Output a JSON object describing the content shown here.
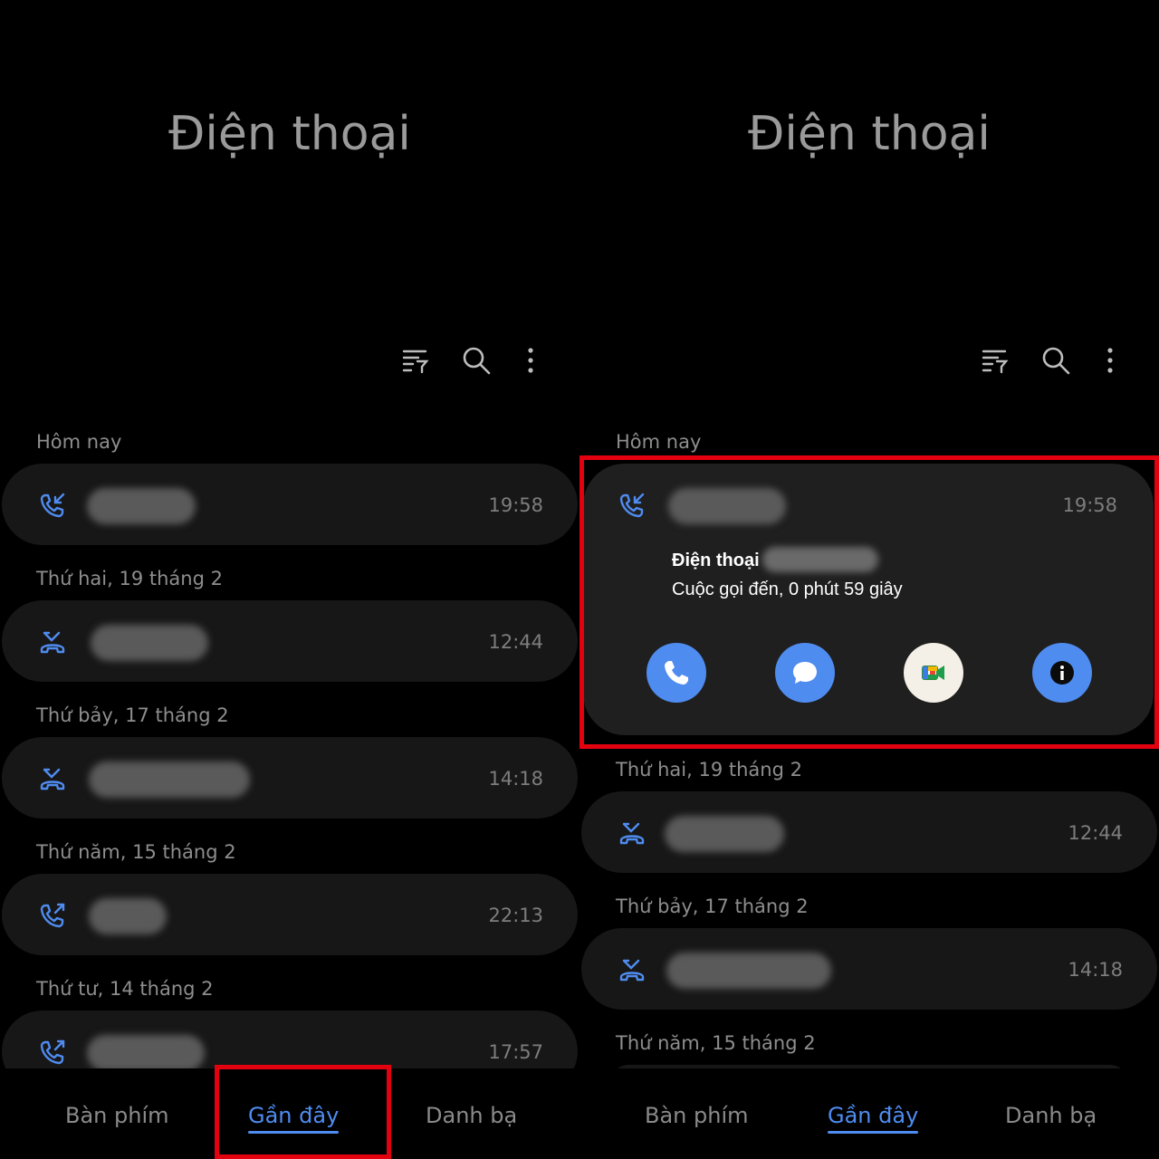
{
  "app": {
    "title": "Điện thoại"
  },
  "icons": {
    "filter": "filter-icon",
    "search": "search-icon",
    "more": "more-vertical-icon",
    "incoming": "incoming-call-icon",
    "outgoing": "outgoing-call-icon",
    "missed": "missed-call-icon",
    "call": "phone-icon",
    "message": "message-icon",
    "video": "meet-video-icon",
    "info": "info-icon"
  },
  "colors": {
    "accent": "#4f8cf0",
    "highlight": "#e3000f",
    "background": "#000000",
    "card": "#171717"
  },
  "left": {
    "sections": [
      {
        "label": "Hôm nay",
        "time": "19:58",
        "type": "incoming"
      },
      {
        "label": "Thứ hai, 19 tháng 2",
        "time": "12:44",
        "type": "missed"
      },
      {
        "label": "Thứ bảy, 17 tháng 2",
        "time": "14:18",
        "type": "missed"
      },
      {
        "label": "Thứ năm, 15 tháng 2",
        "time": "22:13",
        "type": "outgoing"
      },
      {
        "label": "Thứ tư, 14 tháng 2",
        "time": "17:57",
        "type": "outgoing"
      }
    ]
  },
  "right": {
    "sections": [
      {
        "label": "Hôm nay",
        "time": "19:58",
        "type": "incoming"
      },
      {
        "label": "Thứ hai, 19 tháng 2",
        "time": "12:44",
        "type": "missed"
      },
      {
        "label": "Thứ bảy, 17 tháng 2",
        "time": "14:18",
        "type": "missed"
      },
      {
        "label": "Thứ năm, 15 tháng 2"
      }
    ],
    "detail": {
      "title": "Điện thoại",
      "subtitle": "Cuộc gọi đến, 0 phút 59 giây"
    }
  },
  "nav": {
    "tabs": [
      "Bàn phím",
      "Gần đây",
      "Danh bạ"
    ],
    "active": "Gần đây"
  }
}
